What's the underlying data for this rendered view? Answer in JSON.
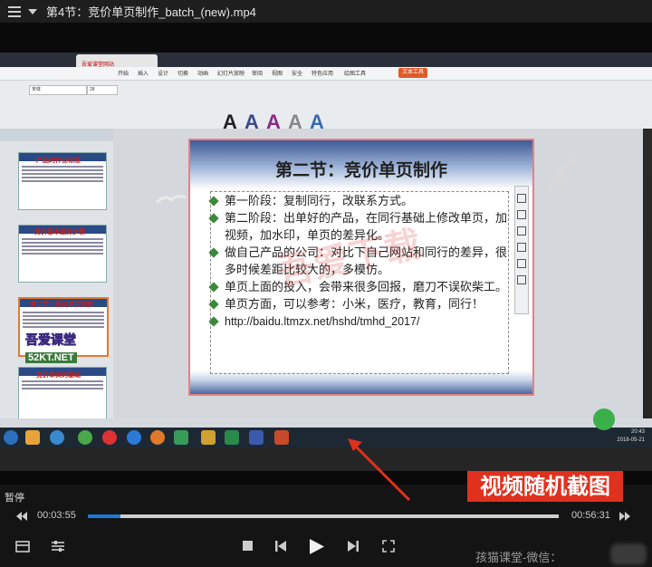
{
  "window": {
    "title": "第4节：竞价单页制作_batch_(new).mp4"
  },
  "video": {
    "browser_tab": "吾爱课堂网站",
    "ribbon_tabs": [
      "开始",
      "插入",
      "设计",
      "切换",
      "动画",
      "幻灯片放映",
      "审阅",
      "视图",
      "安全",
      "特色应用",
      "绘图工具",
      "文本工具"
    ],
    "font_name": "宋体",
    "font_size": "28",
    "slide": {
      "title": "第二节：竞价单页制作",
      "bullets": [
        "第一阶段：复制同行，改联系方式。",
        "第二阶段：出单好的产品，在同行基础上修改单页，加视频，加水印，单页的差异化。",
        "做自己产品的公司：对比下自己网站和同行的差异，很多时候差距比较大的，多模仿。",
        "单页上面的投入，会带来很多回报，磨刀不误砍柴工。",
        "单页方面，可以参考：小米，医疗，教育，同行！"
      ],
      "url": "http://baidu.ltmzx.net/hshd/tmhd_2017/",
      "watermark": "吾爱下载"
    },
    "sidebar": {
      "thumbs": [
        "产品的作业标准",
        "竞价基本服务步骤",
        "第二节：竞价单页制作",
        "竞价单页的基础"
      ],
      "logo_line1": "吾爱课堂",
      "logo_line2": "52KT.NET"
    },
    "clock": {
      "time": "20:43",
      "date": "2018-05-21"
    },
    "caption": "视频随机截图"
  },
  "player": {
    "state_label": "暂停",
    "current_time": "00:03:55",
    "total_time": "00:56:31",
    "progress": 0.069
  },
  "footer": {
    "watermark": "孩猫课堂-微信："
  },
  "colors": {
    "accent": "#1e78d6",
    "caption_bg": "#e0301e",
    "slide_band": "#3e5a95"
  }
}
